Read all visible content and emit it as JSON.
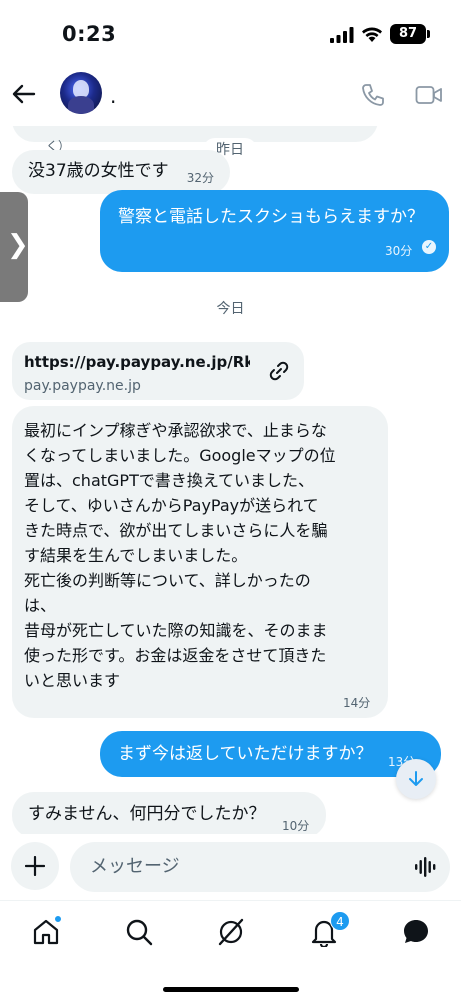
{
  "status_bar": {
    "time": "0:23",
    "battery": "87"
  },
  "header": {
    "contact_name": "."
  },
  "chat": {
    "date_yesterday": "昨日",
    "date_today": "今日",
    "partial_tail": "く）",
    "messages": [
      {
        "direction": "in",
        "text": "没37歳の女性です",
        "time": "32分"
      },
      {
        "direction": "out",
        "text": "警察と電話したスクショもらえますか？",
        "time": "30分"
      },
      {
        "direction": "in",
        "type": "link",
        "url": "https://pay.paypay.ne.jp/Rkv...",
        "domain": "pay.paypay.ne.jp"
      },
      {
        "direction": "in",
        "text": "最初にインプ稼ぎや承認欲求で、止まらな\nくなってしまいました。Googleマップの位\n置は、chatGPTで書き換えていました、\nそして、ゆいさんからPayPayが送られて\nきた時点で、欲が出てしまいさらに人を騙\nす結果を生んでしまいました。\n死亡後の判断等について、詳しかったの\nは、\n昔母が死亡していた際の知識を、そのまま\n使った形です。お金は返金をさせて頂きた\nいと思います",
        "time": "14分"
      },
      {
        "direction": "out",
        "text": "まず今は返していただけますか？",
        "time": "13分"
      },
      {
        "direction": "in",
        "text": "すみません、何円分でしたか？",
        "time": "10分"
      }
    ]
  },
  "composer": {
    "placeholder": "メッセージ"
  },
  "tabbar": {
    "notifications_badge": "4"
  }
}
